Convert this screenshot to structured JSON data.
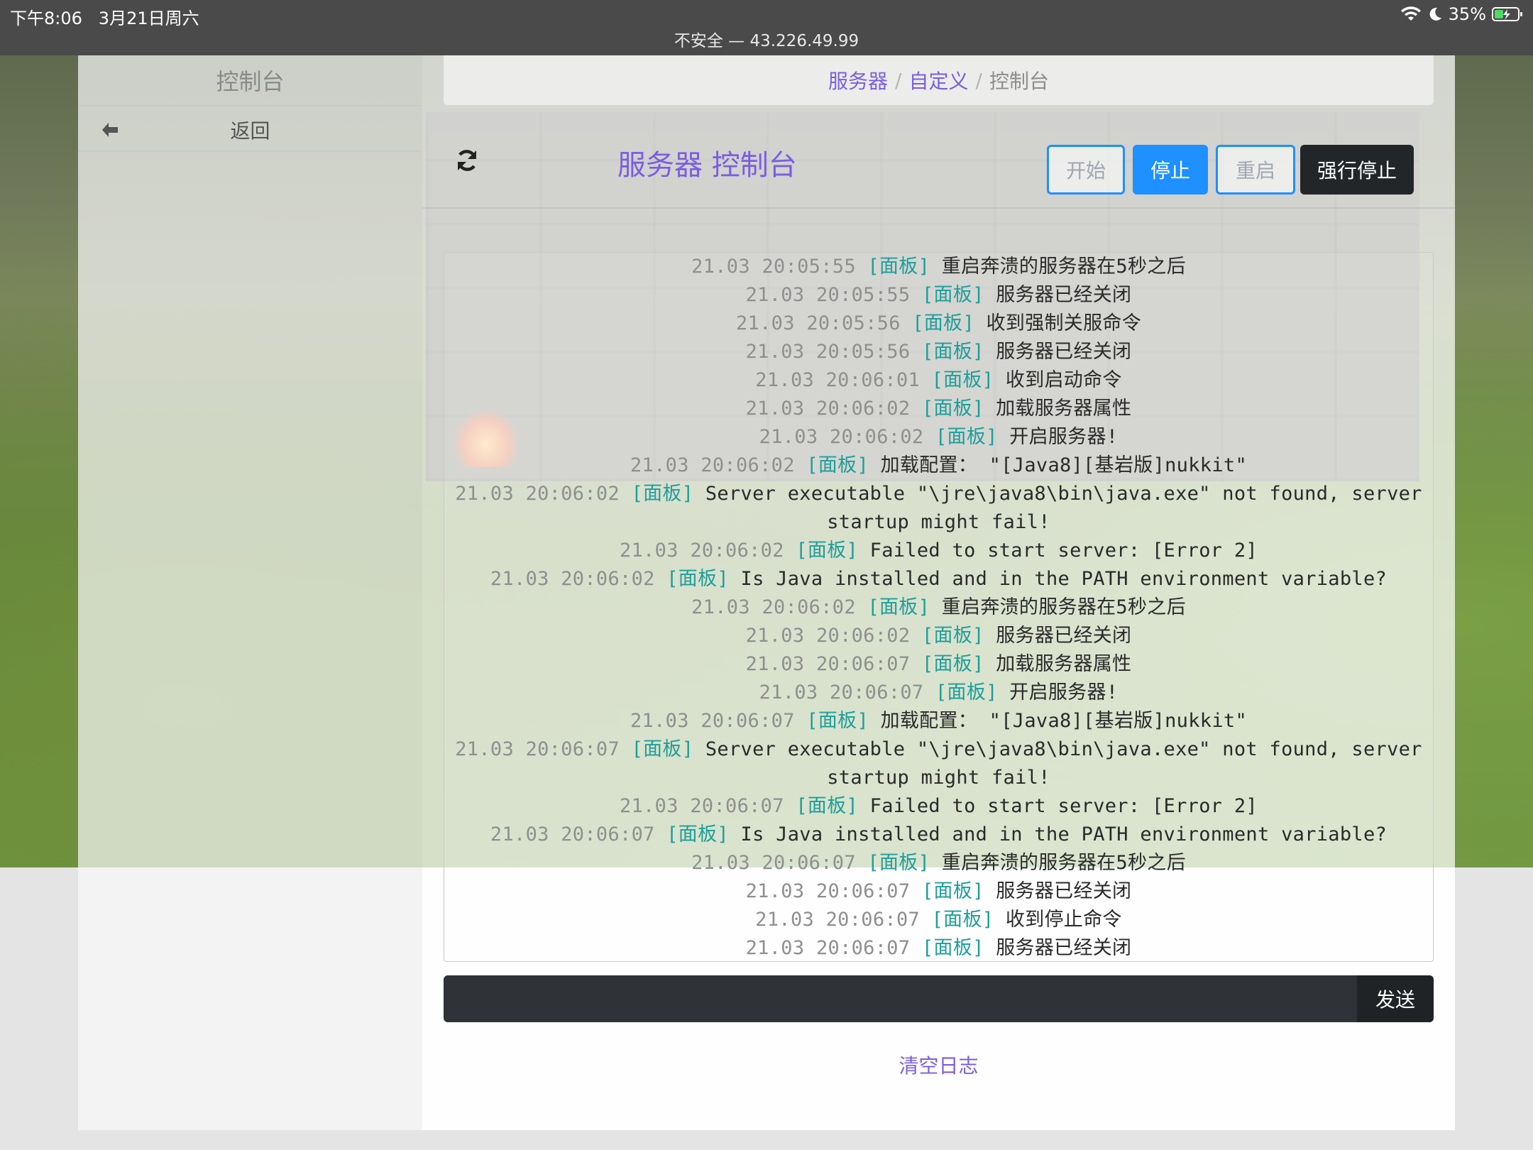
{
  "status_bar": {
    "time": "下午8:06",
    "date": "3月21日周六",
    "url": "不安全 — 43.226.49.99",
    "battery": "35%"
  },
  "sidebar": {
    "title": "控制台",
    "back_label": "返回"
  },
  "breadcrumb": {
    "items": [
      "服务器",
      "自定义"
    ],
    "current": "控制台"
  },
  "header": {
    "title": "服务器 控制台",
    "buttons": {
      "start": "开始",
      "stop": "停止",
      "restart": "重启",
      "kill": "强行停止"
    }
  },
  "console": {
    "lines": [
      {
        "time": "21.03 20:05:55",
        "tag": "[面板]",
        "msg": "重启奔溃的服务器在5秒之后"
      },
      {
        "time": "21.03 20:05:55",
        "tag": "[面板]",
        "msg": "服务器已经关闭"
      },
      {
        "time": "21.03 20:05:56",
        "tag": "[面板]",
        "msg": "收到强制关服命令"
      },
      {
        "time": "21.03 20:05:56",
        "tag": "[面板]",
        "msg": "服务器已经关闭"
      },
      {
        "time": "21.03 20:06:01",
        "tag": "[面板]",
        "msg": "收到启动命令"
      },
      {
        "time": "21.03 20:06:02",
        "tag": "[面板]",
        "msg": "加载服务器属性"
      },
      {
        "time": "21.03 20:06:02",
        "tag": "[面板]",
        "msg": "开启服务器!"
      },
      {
        "time": "21.03 20:06:02",
        "tag": "[面板]",
        "msg": "加载配置： \"[Java8][基岩版]nukkit\""
      },
      {
        "time": "21.03 20:06:02",
        "tag": "[面板]",
        "msg": "Server executable \"\\jre\\java8\\bin\\java.exe\" not found, server startup might fail!"
      },
      {
        "time": "21.03 20:06:02",
        "tag": "[面板]",
        "msg": "Failed to start server: [Error 2]"
      },
      {
        "time": "21.03 20:06:02",
        "tag": "[面板]",
        "msg": "Is Java installed and in the PATH environment variable?"
      },
      {
        "time": "21.03 20:06:02",
        "tag": "[面板]",
        "msg": "重启奔溃的服务器在5秒之后"
      },
      {
        "time": "21.03 20:06:02",
        "tag": "[面板]",
        "msg": "服务器已经关闭"
      },
      {
        "time": "21.03 20:06:07",
        "tag": "[面板]",
        "msg": "加载服务器属性"
      },
      {
        "time": "21.03 20:06:07",
        "tag": "[面板]",
        "msg": "开启服务器!"
      },
      {
        "time": "21.03 20:06:07",
        "tag": "[面板]",
        "msg": "加载配置： \"[Java8][基岩版]nukkit\""
      },
      {
        "time": "21.03 20:06:07",
        "tag": "[面板]",
        "msg": "Server executable \"\\jre\\java8\\bin\\java.exe\" not found, server startup might fail!"
      },
      {
        "time": "21.03 20:06:07",
        "tag": "[面板]",
        "msg": "Failed to start server: [Error 2]"
      },
      {
        "time": "21.03 20:06:07",
        "tag": "[面板]",
        "msg": "Is Java installed and in the PATH environment variable?"
      },
      {
        "time": "21.03 20:06:07",
        "tag": "[面板]",
        "msg": "重启奔溃的服务器在5秒之后"
      },
      {
        "time": "21.03 20:06:07",
        "tag": "[面板]",
        "msg": "服务器已经关闭"
      },
      {
        "time": "21.03 20:06:07",
        "tag": "[面板]",
        "msg": "收到停止命令"
      },
      {
        "time": "21.03 20:06:07",
        "tag": "[面板]",
        "msg": "服务器已经关闭"
      }
    ]
  },
  "command": {
    "value": "",
    "send_label": "发送"
  },
  "footer": {
    "clear_label": "清空日志"
  },
  "colors": {
    "accent": "#7a5ee0",
    "primary": "#1e90ff",
    "log_tag": "#1e9e9a",
    "dark": "#222629"
  }
}
